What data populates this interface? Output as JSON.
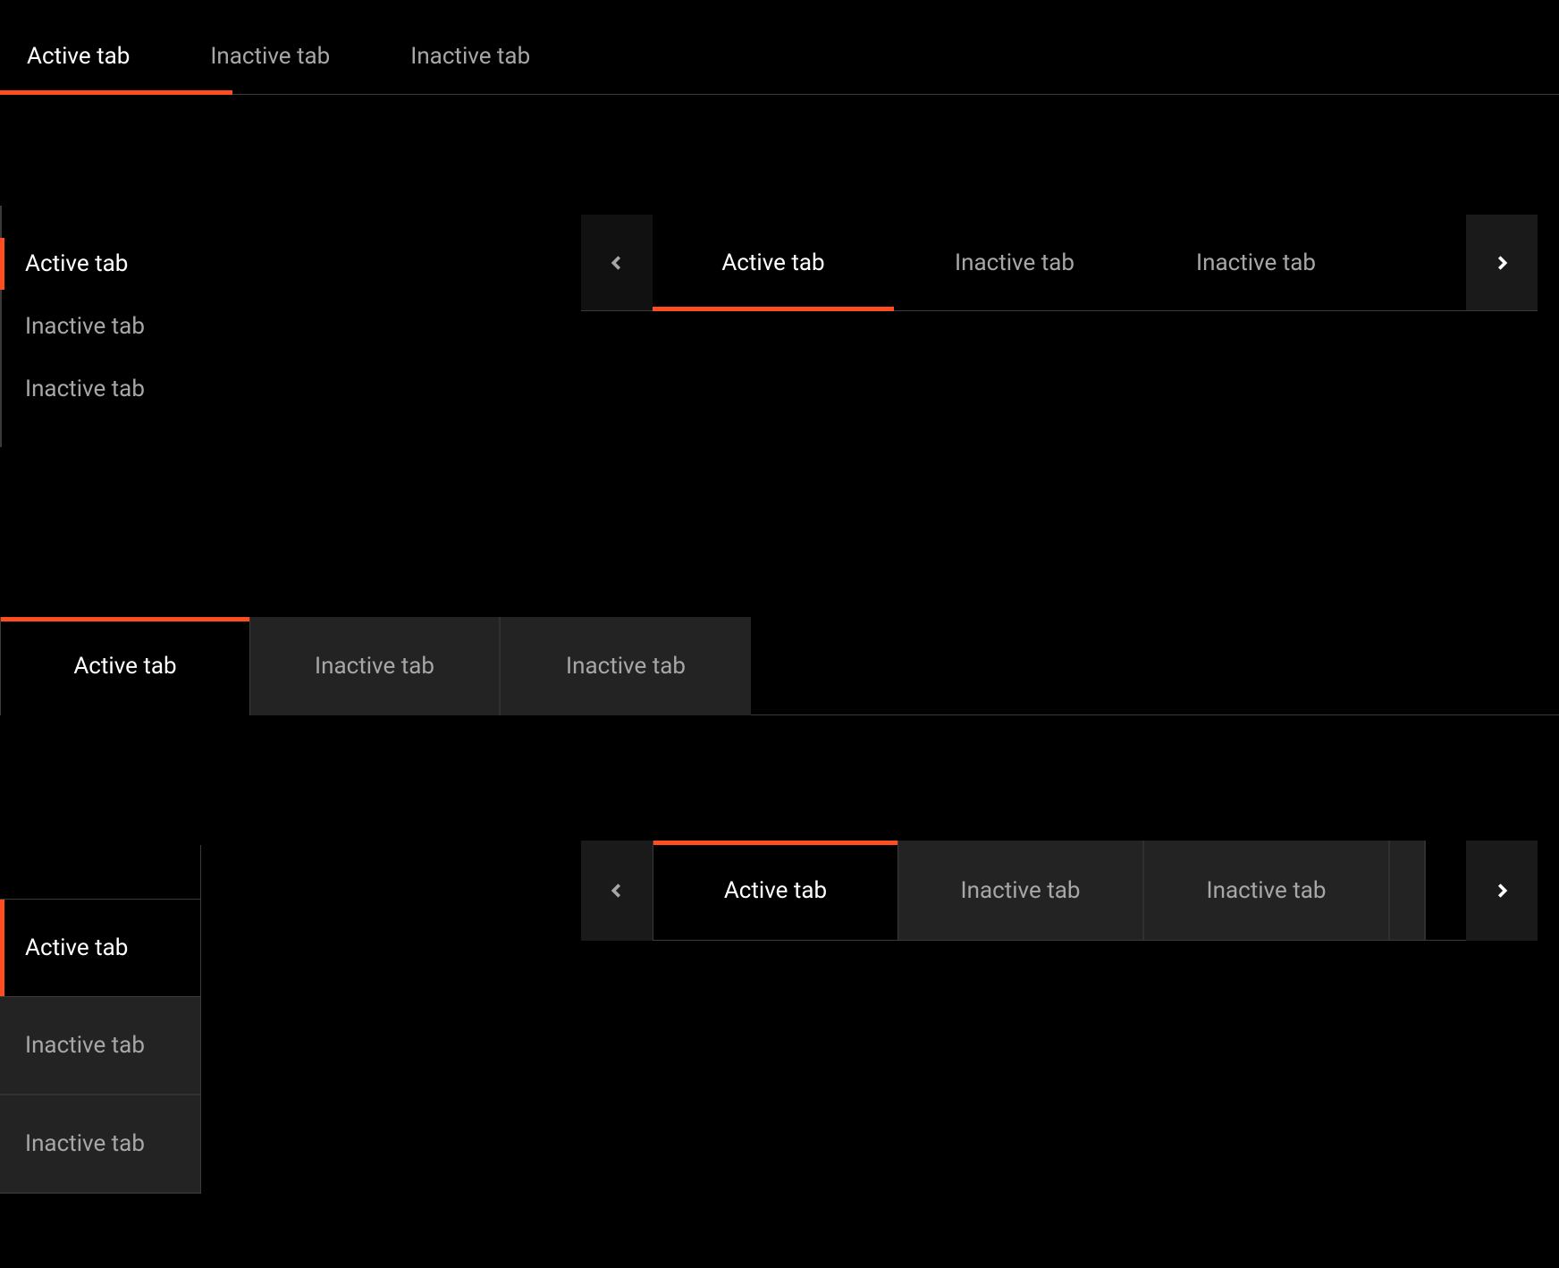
{
  "accent_color": "#ff4d1f",
  "group1": {
    "tabs": [
      {
        "label": "Active tab",
        "active": true
      },
      {
        "label": "Inactive tab",
        "active": false
      },
      {
        "label": "Inactive tab",
        "active": false
      }
    ]
  },
  "group2": {
    "tabs": [
      {
        "label": "Active tab",
        "active": true
      },
      {
        "label": "Inactive tab",
        "active": false
      },
      {
        "label": "Inactive tab",
        "active": false
      }
    ]
  },
  "group3": {
    "scroll_left_enabled": false,
    "scroll_right_enabled": true,
    "tabs": [
      {
        "label": "Active tab",
        "active": true
      },
      {
        "label": "Inactive tab",
        "active": false
      },
      {
        "label": "Inactive tab",
        "active": false
      }
    ]
  },
  "group4": {
    "tabs": [
      {
        "label": "Active tab",
        "active": true
      },
      {
        "label": "Inactive tab",
        "active": false
      },
      {
        "label": "Inactive tab",
        "active": false
      }
    ]
  },
  "group5": {
    "tabs": [
      {
        "label": "Active tab",
        "active": true
      },
      {
        "label": "Inactive tab",
        "active": false
      },
      {
        "label": "Inactive tab",
        "active": false
      }
    ]
  },
  "group6": {
    "scroll_left_enabled": false,
    "scroll_right_enabled": true,
    "tabs": [
      {
        "label": "Active tab",
        "active": true
      },
      {
        "label": "Inactive tab",
        "active": false
      },
      {
        "label": "Inactive tab",
        "active": false
      }
    ]
  }
}
